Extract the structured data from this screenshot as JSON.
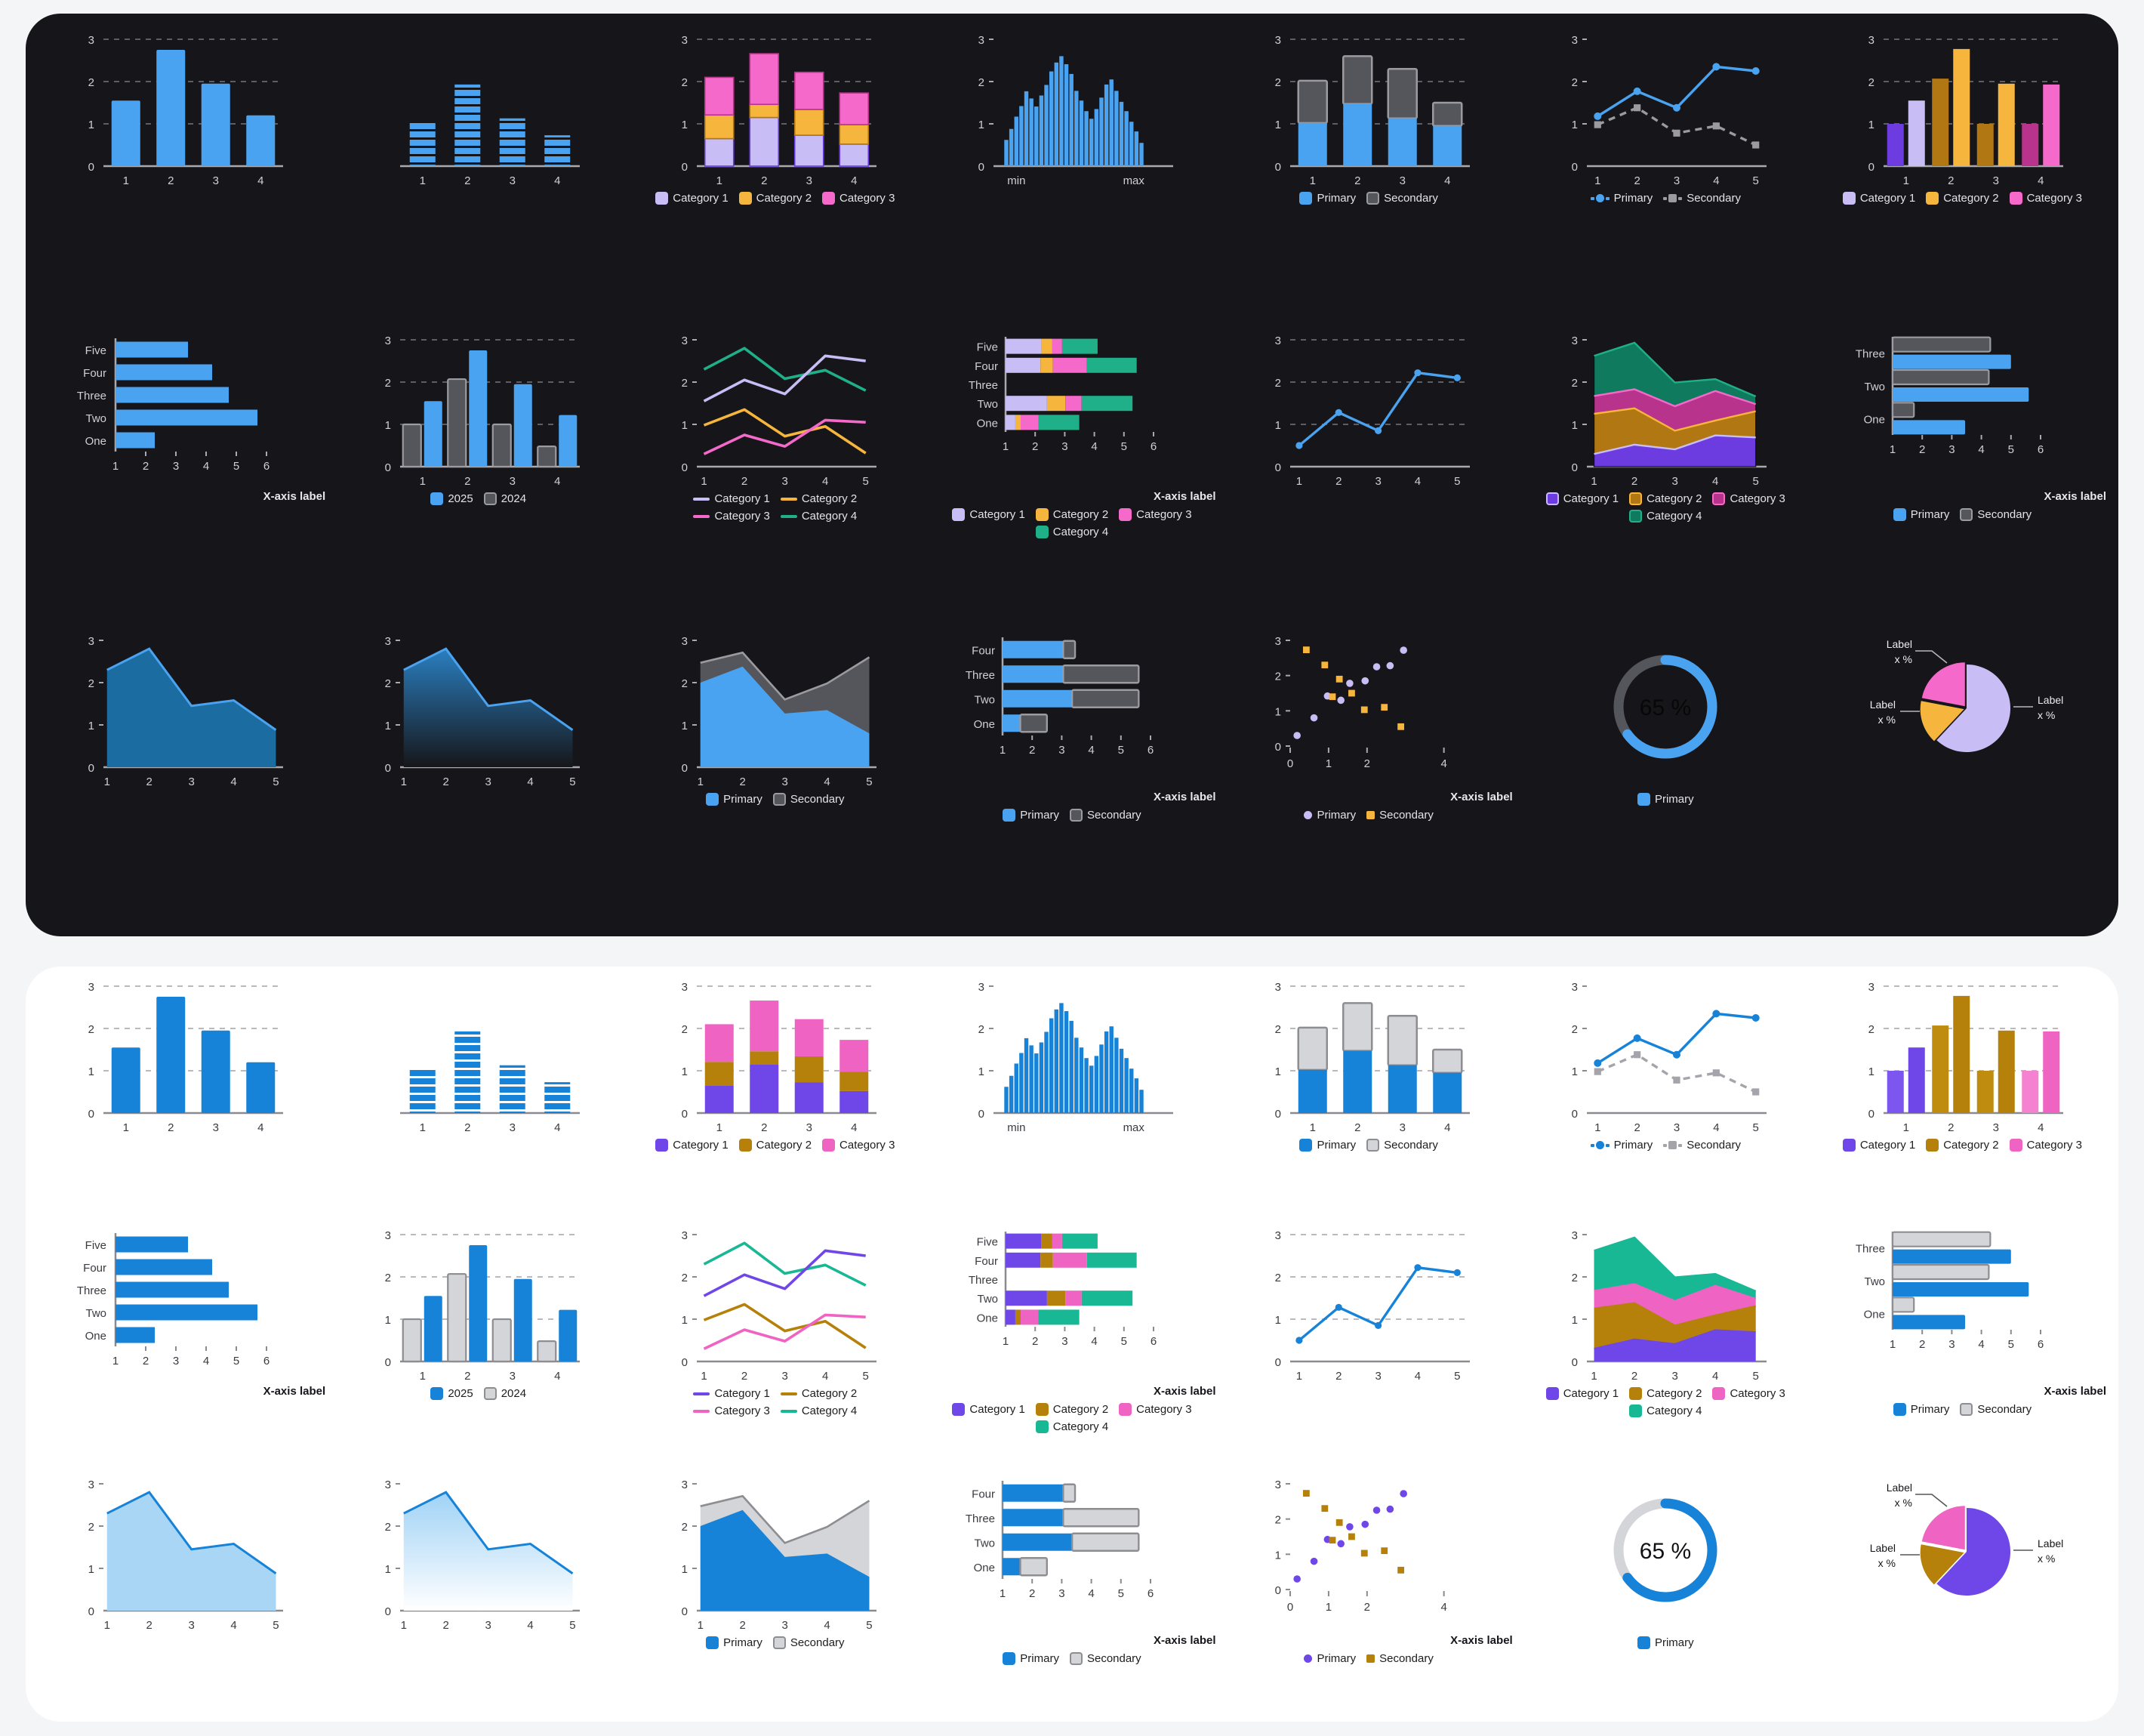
{
  "themes": [
    {
      "id": "dark",
      "bg": "#16161a",
      "text": "#e3e3e6",
      "axis": "#a9a9ae",
      "grid": "#5d5d63",
      "primary": "#4aa3f0",
      "secondary": "#55565b",
      "secondary_border": "#9a9a9f",
      "cat": [
        "#c9bdf5",
        "#f6b53c",
        "#f469ca",
        "#1fb089"
      ],
      "cat_alt": [
        "#6c3ce0",
        "#b07712",
        "#b8338c",
        "#0f7a5d"
      ],
      "area_fill": "#1b6ca0"
    },
    {
      "id": "light",
      "bg": "#ffffff",
      "text": "#1d1d20",
      "axis": "#8a8a90",
      "grid": "#b9b9bf",
      "primary": "#1683d8",
      "secondary": "#d4d5d8",
      "secondary_border": "#8d8d92",
      "cat": [
        "#6f47e8",
        "#b5810a",
        "#ef63c2",
        "#18b894"
      ],
      "cat_alt": [
        "#7d55ef",
        "#c08c10",
        "#f581d1",
        "#8ae2c8"
      ],
      "area_fill": "#aad6f5"
    }
  ],
  "labels": {
    "x_axis_label": "X-axis label",
    "min": "min",
    "max": "max",
    "primary": "Primary",
    "secondary": "Secondary",
    "year_current": "2025",
    "year_previous": "2024",
    "categories": [
      "Category 1",
      "Category 2",
      "Category 3",
      "Category 4"
    ],
    "pie_label": "Label",
    "pie_value": "x %",
    "donut_value": "65 %"
  },
  "chart_data": [
    {
      "id": "bar-simple",
      "type": "bar",
      "title": "",
      "categories": [
        "1",
        "2",
        "3",
        "4"
      ],
      "values": [
        1.55,
        2.75,
        1.95,
        1.2
      ],
      "ylim": [
        0,
        3
      ],
      "yticks": [
        0,
        1,
        2,
        3
      ],
      "grid": true,
      "xlabel": "",
      "ylabel": ""
    },
    {
      "id": "bar-striped",
      "type": "bar",
      "style": "striped",
      "categories": [
        "1",
        "2",
        "3",
        "4"
      ],
      "values": [
        1.05,
        1.93,
        1.13,
        0.73
      ],
      "ylim": [
        0,
        3
      ],
      "yticks": [],
      "grid": false,
      "xlabel": "",
      "ylabel": ""
    },
    {
      "id": "bar-stacked",
      "type": "bar",
      "stacked": true,
      "categories": [
        "1",
        "2",
        "3",
        "4"
      ],
      "series": [
        {
          "name": "Category 1",
          "values": [
            0.65,
            1.15,
            0.73,
            0.52
          ]
        },
        {
          "name": "Category 2",
          "values": [
            0.56,
            0.31,
            0.61,
            0.46
          ]
        },
        {
          "name": "Category 3",
          "values": [
            0.89,
            1.2,
            0.88,
            0.75
          ]
        }
      ],
      "ylim": [
        0,
        3
      ],
      "yticks": [
        0,
        1,
        2,
        3
      ],
      "grid": true,
      "legend": "bottom"
    },
    {
      "id": "histogram",
      "type": "bar",
      "style": "histogram",
      "xticklabels": [
        "min",
        "max"
      ],
      "values": [
        0.62,
        0.88,
        1.17,
        1.42,
        1.77,
        1.6,
        1.41,
        1.67,
        1.92,
        2.24,
        2.45,
        2.6,
        2.41,
        2.18,
        1.78,
        1.55,
        1.3,
        1.12,
        1.35,
        1.62,
        1.93,
        2.05,
        1.78,
        1.52,
        1.3,
        1.05,
        0.82,
        0.55
      ],
      "ylim": [
        0,
        3
      ],
      "yticks": [
        0,
        1,
        2,
        3
      ],
      "grid": false
    },
    {
      "id": "bar-stacked-ps",
      "type": "bar",
      "stacked": true,
      "categories": [
        "1",
        "2",
        "3",
        "4"
      ],
      "series": [
        {
          "name": "Primary",
          "values": [
            1.02,
            1.47,
            1.13,
            0.95
          ]
        },
        {
          "name": "Secondary",
          "values": [
            1.0,
            1.13,
            1.17,
            0.55
          ]
        }
      ],
      "ylim": [
        0,
        3
      ],
      "yticks": [
        0,
        1,
        2,
        3
      ],
      "grid": true,
      "legend": "bottom"
    },
    {
      "id": "line-dual",
      "type": "line",
      "x": [
        "1",
        "2",
        "3",
        "4",
        "5"
      ],
      "series": [
        {
          "name": "Primary",
          "values": [
            1.18,
            1.77,
            1.38,
            2.35,
            2.25
          ],
          "marker": "circle",
          "dash": false
        },
        {
          "name": "Secondary",
          "values": [
            0.98,
            1.38,
            0.78,
            0.95,
            0.5
          ],
          "marker": "square",
          "dash": true
        }
      ],
      "ylim": [
        0,
        3
      ],
      "yticks": [
        0,
        1,
        2,
        3
      ],
      "grid": false,
      "legend": "bottom"
    },
    {
      "id": "bar-grouped-cat",
      "type": "bar",
      "grouped": true,
      "categories": [
        "1",
        "2",
        "3",
        "4"
      ],
      "pairs": [
        {
          "cat": 0,
          "dark": 1.0,
          "light": 1.55
        },
        {
          "cat": 1,
          "dark": 2.07,
          "light": 2.77
        },
        {
          "cat": 2,
          "dark": 1.0,
          "light": 1.95
        },
        {
          "cat": 3,
          "dark": 1.0,
          "light": 1.93
        }
      ],
      "ylim": [
        0,
        3
      ],
      "yticks": [
        0,
        1,
        2,
        3
      ],
      "grid": true,
      "legend": "bottom"
    },
    {
      "id": "hbar-simple",
      "type": "bar",
      "orientation": "horizontal",
      "categories": [
        "One",
        "Two",
        "Three",
        "Four",
        "Five"
      ],
      "values": [
        2.3,
        5.7,
        4.75,
        4.2,
        3.4
      ],
      "xlim": [
        1,
        6
      ],
      "xticks": [
        1,
        2,
        3,
        4,
        5,
        6
      ],
      "xlabel": "X-axis label"
    },
    {
      "id": "bar-grouped-years",
      "type": "bar",
      "grouped": true,
      "categories": [
        "1",
        "2",
        "3",
        "4"
      ],
      "series": [
        {
          "name": "2024",
          "values": [
            1.0,
            2.07,
            1.0,
            0.48
          ]
        },
        {
          "name": "2025",
          "values": [
            1.55,
            2.75,
            1.95,
            1.22
          ]
        }
      ],
      "ylim": [
        0,
        3
      ],
      "yticks": [
        0,
        1,
        2,
        3
      ],
      "grid": true,
      "legend": "bottom"
    },
    {
      "id": "line-multi",
      "type": "line",
      "x": [
        "1",
        "2",
        "3",
        "4",
        "5"
      ],
      "series": [
        {
          "name": "Category 1",
          "values": [
            1.55,
            2.05,
            1.72,
            2.62,
            2.5
          ]
        },
        {
          "name": "Category 2",
          "values": [
            0.98,
            1.35,
            0.72,
            0.95,
            0.32
          ]
        },
        {
          "name": "Category 3",
          "values": [
            0.3,
            0.75,
            0.48,
            1.1,
            1.05
          ]
        },
        {
          "name": "Category 4",
          "values": [
            2.3,
            2.8,
            2.08,
            2.28,
            1.8
          ]
        }
      ],
      "ylim": [
        0,
        3
      ],
      "yticks": [
        0,
        1,
        2,
        3
      ],
      "grid": false,
      "legend": "bottom"
    },
    {
      "id": "hbar-stacked-cat",
      "type": "bar",
      "orientation": "horizontal",
      "stacked": true,
      "categories": [
        "One",
        "Two",
        "Three",
        "Four",
        "Five"
      ],
      "series": [
        {
          "name": "Category 1",
          "values": [
            0.33,
            1.4,
            0.0,
            1.18,
            1.2
          ]
        },
        {
          "name": "Category 2",
          "values": [
            0.18,
            0.62,
            0.0,
            0.42,
            0.38
          ]
        },
        {
          "name": "Category 3",
          "values": [
            0.6,
            0.55,
            0.0,
            1.15,
            0.33
          ]
        },
        {
          "name": "Category 4",
          "values": [
            1.38,
            1.72,
            0.0,
            1.68,
            1.2
          ]
        }
      ],
      "xlim": [
        1,
        6
      ],
      "xticks": [
        1,
        2,
        3,
        4,
        5,
        6
      ],
      "xlabel": "X-axis label",
      "legend": "bottom"
    },
    {
      "id": "line-single",
      "type": "line",
      "x": [
        "1",
        "2",
        "3",
        "4",
        "5"
      ],
      "series": [
        {
          "name": "Primary",
          "values": [
            0.5,
            1.28,
            0.85,
            2.22,
            2.1
          ]
        }
      ],
      "ylim": [
        0,
        3
      ],
      "yticks": [
        0,
        1,
        2,
        3
      ],
      "grid": true
    },
    {
      "id": "area-stacked-cat",
      "type": "area",
      "stacked": true,
      "x": [
        "1",
        "2",
        "3",
        "4",
        "5"
      ],
      "series": [
        {
          "name": "Category 1",
          "values": [
            0.3,
            0.52,
            0.41,
            0.74,
            0.69
          ]
        },
        {
          "name": "Category 2",
          "values": [
            0.95,
            0.86,
            0.44,
            0.35,
            0.62
          ]
        },
        {
          "name": "Category 3",
          "values": [
            0.42,
            0.45,
            0.58,
            0.7,
            0.17
          ]
        },
        {
          "name": "Category 4",
          "values": [
            0.95,
            1.1,
            0.56,
            0.28,
            0.18
          ]
        }
      ],
      "ylim": [
        0,
        3
      ],
      "yticks": [
        0,
        1,
        2,
        3
      ],
      "grid": false,
      "legend": "bottom"
    },
    {
      "id": "hbar-grouped-ps",
      "type": "bar",
      "orientation": "horizontal",
      "grouped": true,
      "categories": [
        "One",
        "Two",
        "Three",
        "Four"
      ],
      "series": [
        {
          "name": "Primary",
          "values": [
            3.45,
            5.6,
            5.0,
            0.0
          ]
        },
        {
          "name": "Secondary",
          "values": [
            1.72,
            4.25,
            4.3,
            0.0
          ]
        }
      ],
      "xlim": [
        1,
        6
      ],
      "xticks": [
        1,
        2,
        3,
        4,
        5,
        6
      ],
      "xlabel": "X-axis label",
      "legend": "bottom"
    },
    {
      "id": "area-flat",
      "type": "area",
      "x": [
        "1",
        "2",
        "3",
        "4",
        "5"
      ],
      "series": [
        {
          "name": "Primary",
          "values": [
            2.3,
            2.8,
            1.45,
            1.58,
            0.88
          ]
        }
      ],
      "ylim": [
        0,
        3
      ],
      "yticks": [
        0,
        1,
        2,
        3
      ],
      "grid": false
    },
    {
      "id": "area-gradient",
      "type": "area",
      "fill": "gradient",
      "x": [
        "1",
        "2",
        "3",
        "4",
        "5"
      ],
      "series": [
        {
          "name": "Primary",
          "values": [
            2.3,
            2.8,
            1.45,
            1.58,
            0.88
          ]
        }
      ],
      "ylim": [
        0,
        3
      ],
      "yticks": [
        0,
        1,
        2,
        3
      ],
      "grid": false
    },
    {
      "id": "area-stacked-ps",
      "type": "area",
      "stacked": true,
      "x": [
        "1",
        "2",
        "3",
        "4",
        "5"
      ],
      "series": [
        {
          "name": "Primary",
          "values": [
            2.0,
            2.38,
            1.27,
            1.35,
            0.8
          ]
        },
        {
          "name": "Secondary",
          "values": [
            0.47,
            0.33,
            0.33,
            0.63,
            1.8
          ]
        }
      ],
      "ylim": [
        0,
        3
      ],
      "yticks": [
        0,
        1,
        2,
        3
      ],
      "grid": false,
      "legend": "bottom"
    },
    {
      "id": "hbar-stacked-ps",
      "type": "bar",
      "orientation": "horizontal",
      "stacked": true,
      "categories": [
        "One",
        "Two",
        "Three",
        "Four"
      ],
      "values_primary": [
        1.6,
        3.35,
        3.05,
        3.05
      ],
      "values_secondary": [
        0.9,
        2.25,
        2.55,
        0.4
      ],
      "xlim": [
        1,
        6
      ],
      "xticks": [
        1,
        2,
        3,
        4,
        5,
        6
      ],
      "xlabel": "X-axis label",
      "legend": "bottom"
    },
    {
      "id": "scatter",
      "type": "scatter",
      "xlim": [
        0,
        4.4
      ],
      "xticks": [
        0,
        1,
        2,
        4
      ],
      "xticklabels": [
        "0",
        "1",
        "2",
        "4"
      ],
      "ylim": [
        0,
        3
      ],
      "yticks": [
        0,
        1,
        2,
        3
      ],
      "xlabel": "X-axis label",
      "series": [
        {
          "name": "Primary",
          "marker": "circle",
          "points": [
            [
              0.18,
              0.3
            ],
            [
              0.62,
              0.8
            ],
            [
              0.97,
              1.42
            ],
            [
              1.32,
              1.3
            ],
            [
              1.55,
              1.78
            ],
            [
              1.95,
              1.85
            ],
            [
              2.25,
              2.25
            ],
            [
              2.6,
              2.28
            ],
            [
              2.95,
              2.72
            ]
          ]
        },
        {
          "name": "Secondary",
          "marker": "square",
          "points": [
            [
              0.42,
              2.73
            ],
            [
              0.9,
              2.3
            ],
            [
              1.1,
              1.4
            ],
            [
              1.28,
              1.9
            ],
            [
              1.6,
              1.5
            ],
            [
              1.93,
              1.03
            ],
            [
              2.45,
              1.1
            ],
            [
              2.88,
              0.55
            ]
          ]
        }
      ]
    },
    {
      "id": "donut",
      "type": "pie",
      "style": "donut",
      "value": 65,
      "value_label": "65 %",
      "legend": "bottom",
      "series": [
        {
          "name": "Primary",
          "value": 65
        },
        {
          "name": "Remainder",
          "value": 35
        }
      ]
    },
    {
      "id": "pie",
      "type": "pie",
      "slices": [
        {
          "label": "Label",
          "value": "x %",
          "fraction": 0.62
        },
        {
          "label": "Label",
          "value": "x %",
          "fraction": 0.16
        },
        {
          "label": "Label",
          "value": "x %",
          "fraction": 0.22
        }
      ]
    }
  ]
}
